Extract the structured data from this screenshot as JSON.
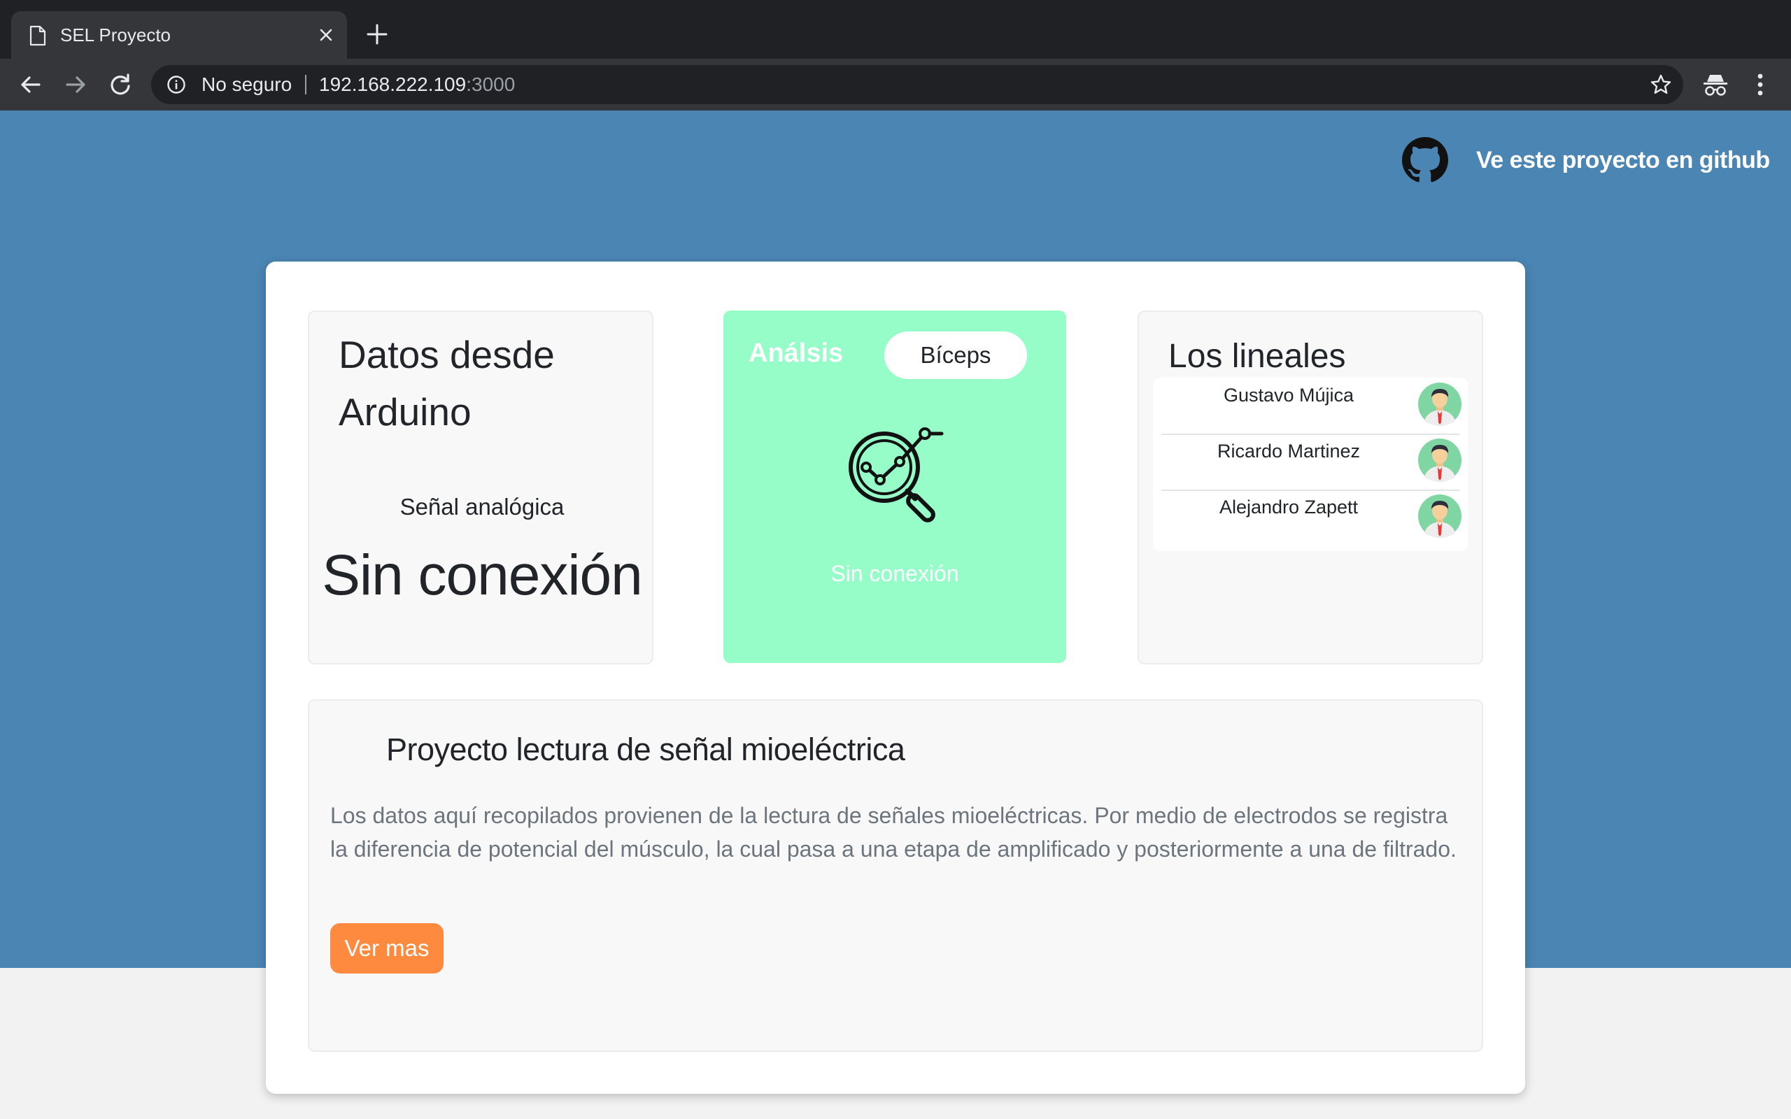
{
  "browser": {
    "tab_title": "SEL Proyecto",
    "security_label": "No seguro",
    "url_host": "192.168.222.109",
    "url_port": ":3000"
  },
  "header": {
    "github_link": "Ve este proyecto en github"
  },
  "arduino_card": {
    "title": "Datos desde Arduino",
    "subtitle": "Señal analógica",
    "status": "Sin conexión"
  },
  "analysis_card": {
    "label": "Análsis",
    "muscle_button": "Bíceps",
    "status": "Sin conexión",
    "background_color": "#96fdc8"
  },
  "team_card": {
    "title": "Los lineales",
    "members": [
      {
        "name": "Gustavo Mújica"
      },
      {
        "name": "Ricardo Martinez"
      },
      {
        "name": "Alejandro Zapett"
      }
    ]
  },
  "project_card": {
    "title": "Proyecto lectura de señal mioeléctrica",
    "description": "Los datos aquí recopilados provienen de la lectura de señales mioeléctricas. Por medio de electrodos se registra la diferencia de potencial del músculo, la cual pasa a una etapa de amplificado y posteriormente a una de filtrado.",
    "button": "Ver mas",
    "button_color": "#fd8a3e"
  },
  "colors": {
    "hero_background": "#4a85b3",
    "accent_green": "#96fdc8"
  }
}
